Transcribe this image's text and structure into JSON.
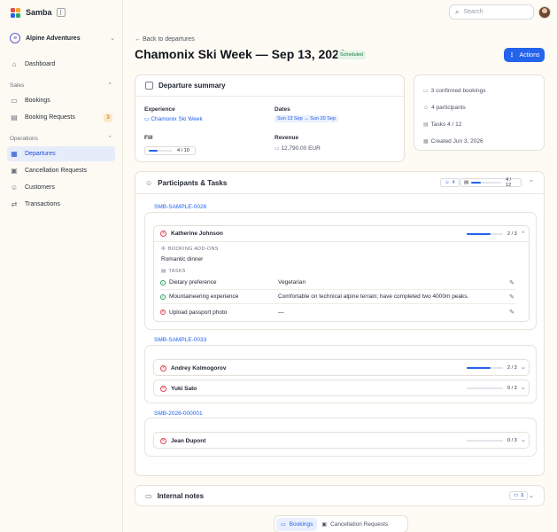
{
  "brand": {
    "name": "Samba",
    "colors": [
      "#e5484d",
      "#f5a524",
      "#2463eb",
      "#30a46c"
    ]
  },
  "sidebar": {
    "org_name": "Alpine Adventures",
    "org_initial": "≡",
    "items_top": [
      {
        "label": "Dashboard",
        "icon": "home-icon"
      }
    ],
    "sections": [
      {
        "title": "Sales",
        "items": [
          {
            "label": "Bookings",
            "icon": "ticket-icon"
          },
          {
            "label": "Booking Requests",
            "icon": "inbox-icon",
            "count": "3"
          }
        ]
      },
      {
        "title": "Operations",
        "items": [
          {
            "label": "Departures",
            "icon": "calendar-icon",
            "active": true
          },
          {
            "label": "Cancellation Requests",
            "icon": "cancel-doc-icon"
          },
          {
            "label": "Customers",
            "icon": "users-icon"
          },
          {
            "label": "Transactions",
            "icon": "transactions-icon"
          }
        ]
      }
    ]
  },
  "topbar": {
    "search_placeholder": "Search"
  },
  "page": {
    "back_label": "← Back to departures",
    "title": "Chamonix Ski Week — Sep 13, 2026",
    "status": "Scheduled",
    "actions_label": "Actions"
  },
  "summary": {
    "title": "Departure summary",
    "experience_label": "Experience",
    "experience_value": "Chamonix Ski Week",
    "dates_label": "Dates",
    "dates_value": "Sun 13 Sep → Sun 20 Sep",
    "fill_label": "Fill",
    "fill_text": "4 / 10",
    "fill_fraction": 0.4,
    "revenue_label": "Revenue",
    "revenue_value": "12,790.00 EUR"
  },
  "stats": [
    "3 confirmed bookings",
    "4 participants",
    "Tasks 4 / 12",
    "Created Jun 3, 2026"
  ],
  "participants": {
    "title": "Participants & Tasks",
    "people_count": "4",
    "tasks_text": "4 / 12",
    "tasks_fraction": 0.33,
    "add_ons_label": "BOOKING ADD-ONS",
    "tasks_label": "TASKS",
    "groups": [
      {
        "ref": "SMB-SAMPLE-0026",
        "people": [
          {
            "name": "Katherine Johnson",
            "progress_text": "2 / 3",
            "progress": 0.67,
            "expanded": true,
            "add_on": "Romantic dinner",
            "tasks": [
              {
                "name": "Dietary preference",
                "value": "Vegetarian",
                "done": true
              },
              {
                "name": "Mountaineering experience",
                "value": "Comfortable on technical alpine terrain; have completed two 4000m peaks.",
                "done": true
              },
              {
                "name": "Upload passport photo",
                "value": "—",
                "done": false
              }
            ]
          }
        ]
      },
      {
        "ref": "SMB-SAMPLE-0033",
        "people": [
          {
            "name": "Andrey Kolmogorov",
            "progress_text": "2 / 3",
            "progress": 0.67
          },
          {
            "name": "Yuki Sato",
            "progress_text": "0 / 3",
            "progress": 0
          }
        ]
      },
      {
        "ref": "SMB-2026-000001",
        "people": [
          {
            "name": "Jean Dupont",
            "progress_text": "0 / 3",
            "progress": 0
          }
        ]
      }
    ]
  },
  "notes": {
    "title": "Internal notes",
    "count": "1"
  },
  "bottom_tabs": [
    {
      "label": "Bookings",
      "active": true
    },
    {
      "label": "Cancellation Requests"
    }
  ]
}
